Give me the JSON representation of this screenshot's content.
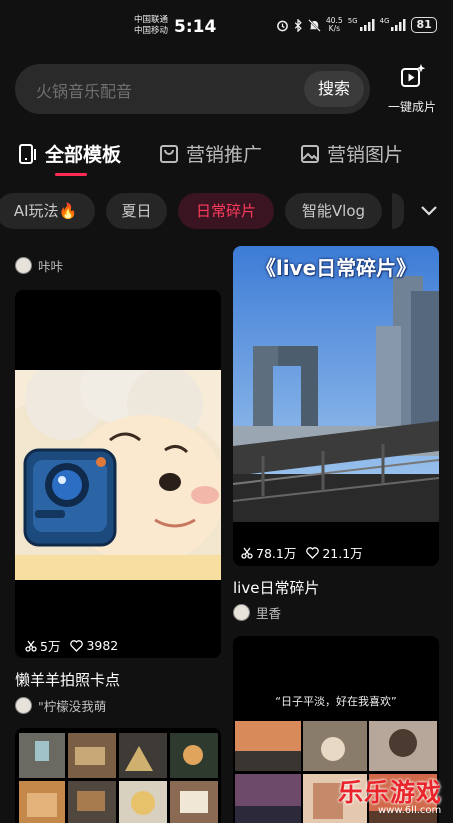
{
  "status_bar": {
    "carrier_1": "中国联通",
    "carrier_2": "中国移动",
    "time": "5:14",
    "speed_value": "40.5",
    "speed_unit": "K/s",
    "network_1": "5G",
    "network_2": "4G",
    "battery": "81"
  },
  "search": {
    "placeholder": "火锅音乐配音",
    "button_label": "搜索"
  },
  "one_click": {
    "label": "一键成片"
  },
  "tabs": [
    {
      "label": "全部模板",
      "icon": "phone-template-icon",
      "active": true
    },
    {
      "label": "营销推广",
      "icon": "shopping-bag-icon",
      "active": false
    },
    {
      "label": "营销图片",
      "icon": "image-icon",
      "active": false
    }
  ],
  "chips": [
    {
      "label": "AI玩法🔥",
      "active": false
    },
    {
      "label": "夏日",
      "active": false
    },
    {
      "label": "日常碎片",
      "active": true
    },
    {
      "label": "智能Vlog",
      "active": false
    }
  ],
  "feed": {
    "left_header_author": "咔咔",
    "card1": {
      "uses": "5万",
      "likes": "3982",
      "title": "懒羊羊拍照卡点",
      "author": "\"柠檬没我萌"
    },
    "card2": {
      "cover_title": "《live日常碎片》",
      "uses": "78.1万",
      "likes": "21.1万",
      "title": "live日常碎片",
      "author": "里香"
    },
    "card4": {
      "quote": "“日子平淡，好在我喜欢”"
    }
  },
  "watermark": {
    "text": "乐乐游戏",
    "url": "www.6ll.com"
  },
  "colors": {
    "background": "#111111",
    "accent": "#fe2c55",
    "chip_bg": "#262626"
  }
}
